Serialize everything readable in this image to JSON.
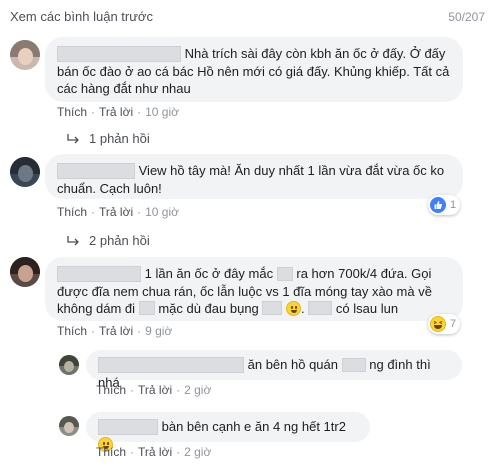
{
  "header": {
    "see_previous": "Xem các bình luận trước",
    "count": "50/207"
  },
  "comments": [
    {
      "text_after_name": "Nhà trích sài đây còn kbh ăn ốc ở đấy. Ở đấy",
      "line2": "bán ốc đào ở ao cá bác Hồ nên mới có giá đấy. Khủng khiếp. Tất cả",
      "line3": "các hàng đắt như nhau",
      "actions": {
        "like": "Thích",
        "reply": "Trả lời",
        "time": "10 giờ"
      },
      "replies_link": "1 phản hồi"
    },
    {
      "text_after_name": "View hồ tây mà! Ăn duy nhất 1 lần vừa đắt vừa ốc ko",
      "line2": "chuẩn. Cạch luôn!",
      "actions": {
        "like": "Thích",
        "reply": "Trả lời",
        "time": "10 giờ"
      },
      "reaction_count": "1",
      "replies_link": "2 phản hồi"
    },
    {
      "seg1": "1 lần ăn ốc ở đây mắc",
      "seg2": "ra hơn 700k/4 đứa. Gọi",
      "line2": "được đĩa nem chua rán, ốc lẫn luộc vs 1 đĩa móng tay xào mà về",
      "line3a": "không dám đi",
      "line3b": "mặc dù đau bụng",
      "line3c": ".",
      "line3d": "có lsau lun",
      "actions": {
        "like": "Thích",
        "reply": "Trả lời",
        "time": "9 giờ"
      },
      "reaction_count": "7"
    }
  ],
  "replies": [
    {
      "seg1": "ăn bên hồ quán",
      "seg2": "ng đình thì nhá",
      "actions": {
        "like": "Thích",
        "reply": "Trả lời",
        "time": "2 giờ"
      }
    },
    {
      "text": "bàn bên cạnh e ăn 4 ng hết 1tr2",
      "actions": {
        "like": "Thích",
        "reply": "Trả lời",
        "time": "2 giờ"
      }
    }
  ],
  "colors": {
    "bubble": "#f2f3f5",
    "link": "#4b4f56",
    "meta": "#90949c",
    "like_blue": "#4080ff"
  }
}
